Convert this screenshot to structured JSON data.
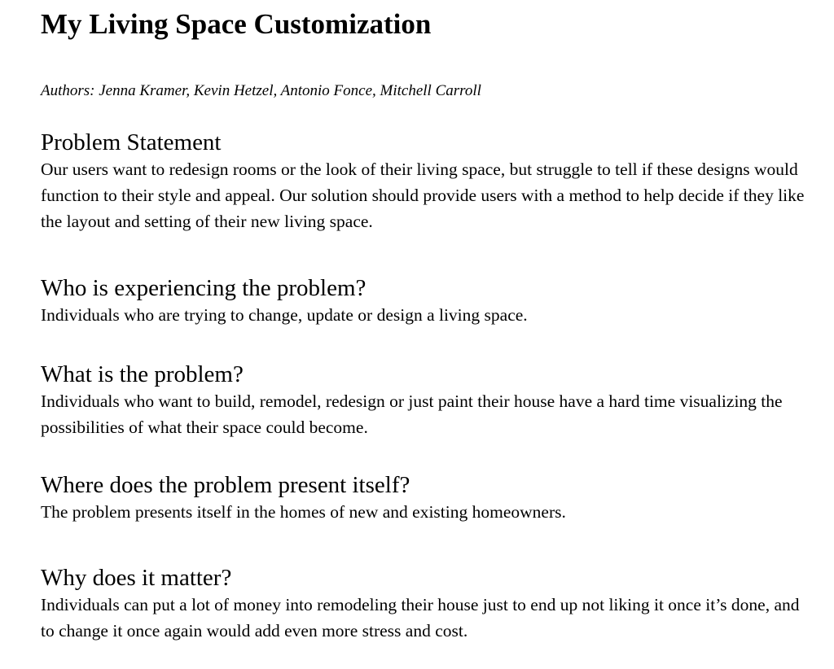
{
  "document": {
    "title": "My Living Space Customization",
    "authors": "Authors: Jenna Kramer, Kevin Hetzel, Antonio Fonce, Mitchell Carroll"
  },
  "sections": [
    {
      "heading": "Problem Statement",
      "body": "Our users want to redesign rooms or the look of their living space, but struggle to tell if these designs would function to their style and appeal. Our solution should provide users with a method to help decide if they like the layout and setting of their new living space."
    },
    {
      "heading": "Who is experiencing the problem?",
      "body": "Individuals who are trying to change, update or design a living space."
    },
    {
      "heading": "What is the problem?",
      "body": "Individuals who want to build, remodel, redesign or just paint their house have a hard time visualizing the possibilities of what their space could become."
    },
    {
      "heading": "Where does the problem present itself?",
      "body": "The problem presents itself in the homes of new and existing homeowners."
    },
    {
      "heading": "Why does it matter?",
      "body": "Individuals can put a lot of money into remodeling their house just to end up not liking it once it’s done, and to change it once again would add even more stress and cost."
    }
  ]
}
